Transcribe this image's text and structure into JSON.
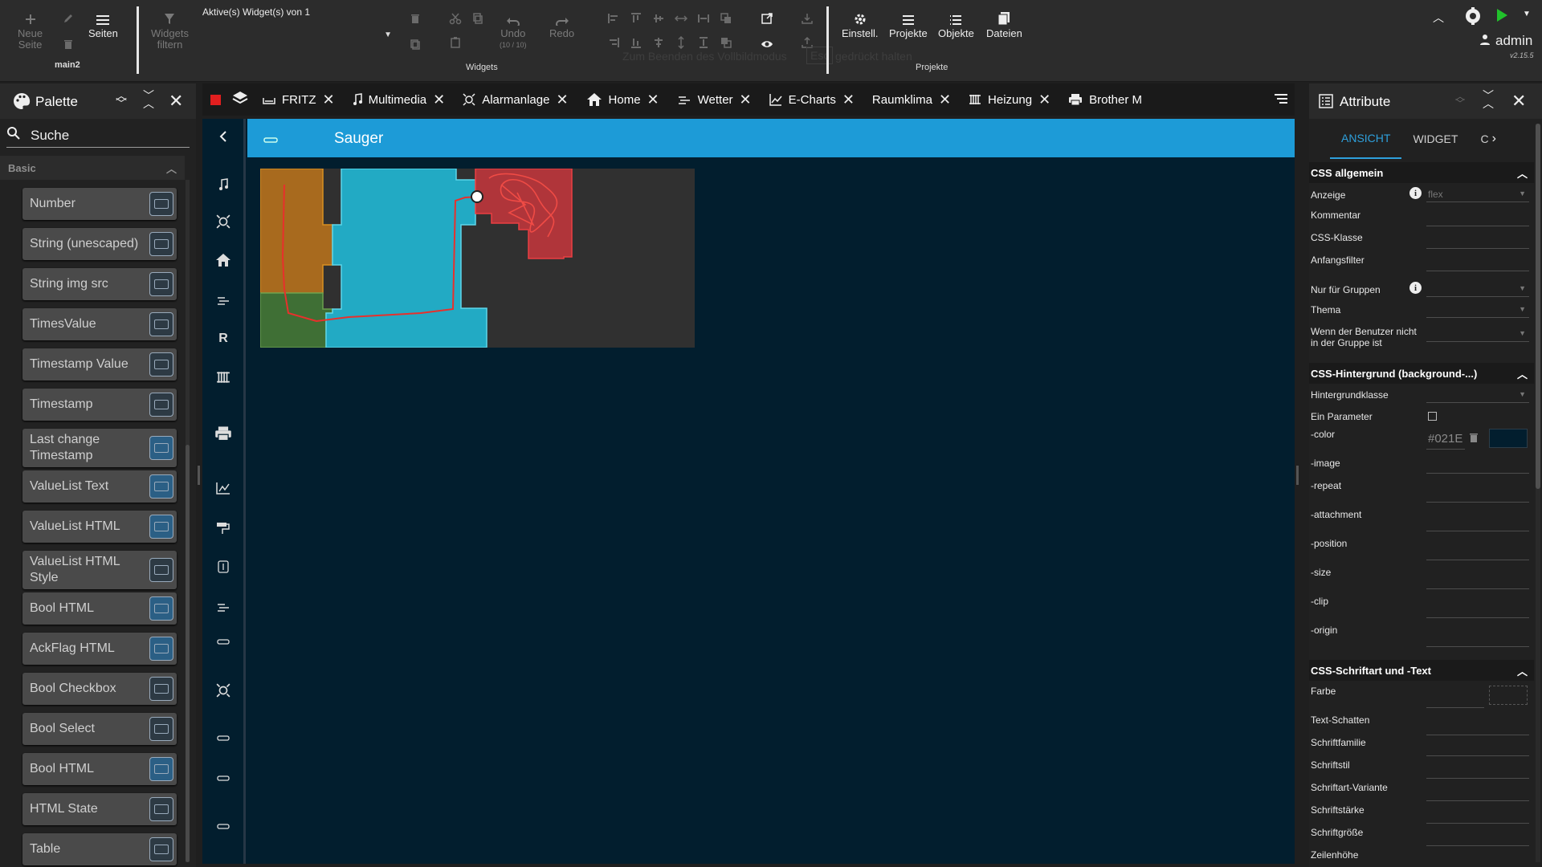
{
  "toolbar": {
    "new_page": "Neue\nSeite",
    "pages": "Seiten",
    "current_page": "main2",
    "widgets_filter": "Widgets\nfiltern",
    "active_widgets": "Aktive(s) Widget(s) von 1",
    "undo": "Undo",
    "undo_counter": "(10 / 10)",
    "redo": "Redo",
    "widgets_group": "Widgets",
    "hint": "Zum Beenden des Vollbildmodus",
    "hint_esc": "Esc",
    "hint_pressed": "gedrückt halten",
    "settings": "Einstell.",
    "projects": "Projekte",
    "objects": "Objekte",
    "files": "Dateien",
    "projects_group": "Projekte",
    "user": "admin",
    "version": "v2.15.5"
  },
  "palette": {
    "title": "Palette",
    "search_placeholder": "Suche",
    "category": "Basic",
    "items": [
      {
        "label": "Number",
        "filled": false
      },
      {
        "label": "String (unescaped)",
        "filled": false
      },
      {
        "label": "String img src",
        "filled": false
      },
      {
        "label": "TimesValue",
        "filled": false
      },
      {
        "label": "Timestamp Value",
        "filled": false
      },
      {
        "label": "Timestamp",
        "filled": false
      },
      {
        "label": "Last change Timestamp",
        "filled": true
      },
      {
        "label": "ValueList Text",
        "filled": true
      },
      {
        "label": "ValueList HTML",
        "filled": true
      },
      {
        "label": "ValueList HTML Style",
        "filled": false
      },
      {
        "label": "Bool HTML",
        "filled": true
      },
      {
        "label": "AckFlag HTML",
        "filled": true
      },
      {
        "label": "Bool Checkbox",
        "filled": false
      },
      {
        "label": "Bool Select",
        "filled": false
      },
      {
        "label": "Bool HTML",
        "filled": true
      },
      {
        "label": "HTML State",
        "filled": false
      },
      {
        "label": "Table",
        "filled": false
      }
    ]
  },
  "tabs": [
    {
      "label": "FRITZ",
      "icon": "sofa-icon"
    },
    {
      "label": "Multimedia",
      "icon": "music-note-icon"
    },
    {
      "label": "Alarmanlage",
      "icon": "alarm-icon"
    },
    {
      "label": "Home",
      "icon": "home-icon"
    },
    {
      "label": "Wetter",
      "icon": "weather-icon"
    },
    {
      "label": "E-Charts",
      "icon": "chart-icon"
    },
    {
      "label": "Raumklima",
      "icon": ""
    },
    {
      "label": "Heizung",
      "icon": "radiator-icon"
    },
    {
      "label": "Brother M",
      "icon": "printer-icon"
    }
  ],
  "view": {
    "title": "Sauger",
    "nav_icons": [
      "music-note-icon",
      "alarm-icon",
      "home-icon",
      "weather-icon",
      "r-letter-icon",
      "radiator-icon",
      "printer-icon",
      "chart-icon",
      "paint-roller-icon",
      "door-icon",
      "weather-icon",
      "vacuum-icon",
      "alarm-icon",
      "vacuum-icon",
      "vacuum-icon",
      "vacuum-icon"
    ]
  },
  "attributes": {
    "title": "Attribute",
    "tabs": [
      "ANSICHT",
      "WIDGET",
      "C"
    ],
    "sections": {
      "general": "CSS allgemein",
      "background": "CSS-Hintergrund (background-...)",
      "font": "CSS-Schriftart und -Text"
    },
    "general": {
      "display_label": "Anzeige",
      "display_value": "flex",
      "comment": "Kommentar",
      "css_class": "CSS-Klasse",
      "filter": "Anfangsfilter",
      "groups": "Nur für Gruppen",
      "theme": "Thema",
      "not_in_group": "Wenn der Benutzer nicht in der Gruppe ist"
    },
    "background": {
      "class": "Hintergrundklasse",
      "one_param": "Ein Parameter",
      "color": "-color",
      "color_value": "#021E",
      "color_swatch": "#021e2e",
      "image": "-image",
      "repeat": "-repeat",
      "attachment": "-attachment",
      "position": "-position",
      "size": "-size",
      "clip": "-clip",
      "origin": "-origin"
    },
    "font": {
      "color": "Farbe",
      "shadow": "Text-Schatten",
      "family": "Schriftfamilie",
      "style": "Schriftstil",
      "variant": "Schriftart-Variante",
      "weight": "Schriftstärke",
      "size": "Schriftgröße",
      "line_height": "Zeilenhöhe"
    }
  },
  "colors": {
    "accent": "#1d9bd7",
    "canvas": "#021e2e",
    "room_orange": "#a86a1e",
    "room_cyan": "#22aac4",
    "room_green": "#3f6f35",
    "room_red": "#b0353a"
  }
}
